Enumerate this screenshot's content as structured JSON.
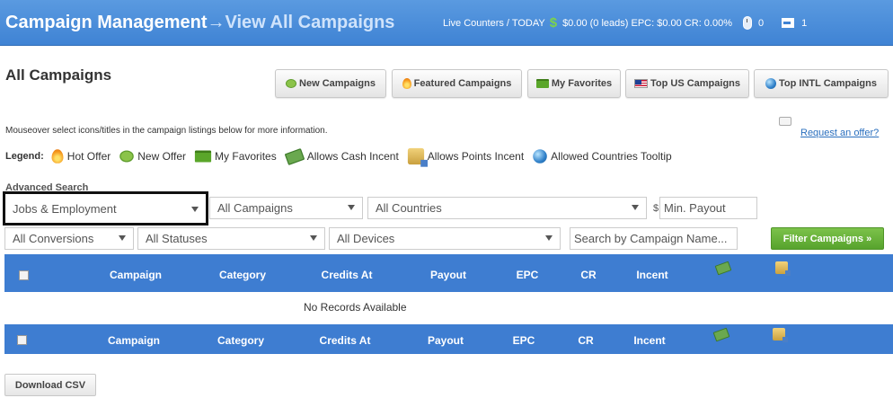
{
  "header": {
    "title_main": "Campaign Management",
    "arrow": "→",
    "title_sub": "View All Campaigns",
    "counters_label": "Live Counters / TODAY",
    "counters_value": "$0.00 (0 leads) EPC: $0.00 CR: 0.00%",
    "clicks": "0",
    "exits": "1"
  },
  "page": {
    "title": "All Campaigns",
    "tabs": [
      {
        "label": "New Campaigns",
        "icon": "new-icon"
      },
      {
        "label": "Featured Campaigns",
        "icon": "hot-icon"
      },
      {
        "label": "My Favorites",
        "icon": "favorites-icon"
      },
      {
        "label": "Top US Campaigns",
        "icon": "us-flag-icon"
      },
      {
        "label": "Top INTL Campaigns",
        "icon": "globe-icon"
      }
    ],
    "info": "Mouseover select icons/titles in the campaign listings below for more information.",
    "request_link": "Request an offer?",
    "legend_label": "Legend:",
    "legend": [
      "Hot Offer",
      "New Offer",
      "My Favorites",
      "Allows Cash Incent",
      "Allows Points Incent",
      "Allowed Countries Tooltip"
    ]
  },
  "search": {
    "title": "Advanced Search",
    "category": "Jobs & Employment",
    "campaigns": "All Campaigns",
    "countries": "All Countries",
    "currency": "$",
    "min_payout_placeholder": "Min. Payout",
    "conversions": "All Conversions",
    "statuses": "All Statuses",
    "devices": "All Devices",
    "search_placeholder": "Search by Campaign Name...",
    "filter_button": "Filter Campaigns »"
  },
  "table": {
    "columns": [
      "Campaign",
      "Category",
      "Credits At",
      "Payout",
      "EPC",
      "CR",
      "Incent"
    ],
    "empty": "No Records Available"
  },
  "download_button": "Download CSV",
  "colors": {
    "header_blue": "#3f83d4",
    "table_blue": "#3e7dd1",
    "accent_green": "#57a32d",
    "link_blue": "#2a6fbe"
  }
}
